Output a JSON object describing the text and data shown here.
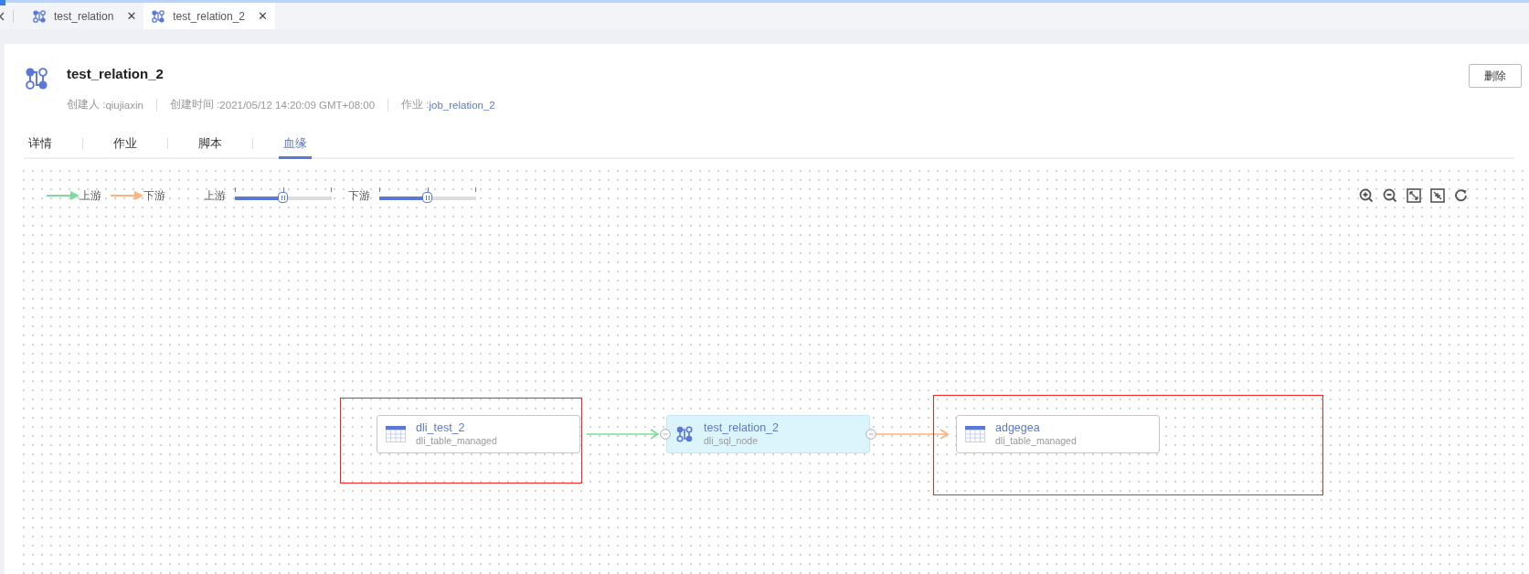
{
  "editor_tabs": [
    {
      "label": "test_relation",
      "close": "✕",
      "selected": false
    },
    {
      "label": "test_relation_2",
      "close": "✕",
      "selected": true
    }
  ],
  "header": {
    "title": "test_relation_2",
    "delete_button": "删除",
    "meta": [
      {
        "label": "创建人 : ",
        "value": "qiujiaxin",
        "link": false
      },
      {
        "label": "创建时间 : ",
        "value": "2021/05/12 14:20:09 GMT+08:00",
        "link": false
      },
      {
        "label": "作业 : ",
        "value": "job_relation_2",
        "link": true
      }
    ]
  },
  "tabs": [
    {
      "label": "详情",
      "selected": false
    },
    {
      "label": "作业",
      "selected": false
    },
    {
      "label": "脚本",
      "selected": false
    },
    {
      "label": "血缘",
      "selected": true
    }
  ],
  "legend": [
    {
      "label": "上游",
      "kind": "upstream",
      "color": "#7ddc9c"
    },
    {
      "label": "下游",
      "kind": "downstream",
      "color": "#ffb27a"
    }
  ],
  "sliders": [
    {
      "label": "上游",
      "level": 0.5
    },
    {
      "label": "下游",
      "level": 0.5
    }
  ],
  "nodes": [
    {
      "kind": "table",
      "name": "dli_test_2",
      "type": "dli_table_managed",
      "highlighted": true
    },
    {
      "kind": "job",
      "name": "test_relation_2",
      "type": "dli_sql_node",
      "highlighted": false
    },
    {
      "kind": "table",
      "name": "adgegea",
      "type": "dli_table_managed",
      "highlighted": true
    }
  ],
  "edges": [
    {
      "kind": "upstream"
    },
    {
      "kind": "downstream"
    }
  ]
}
